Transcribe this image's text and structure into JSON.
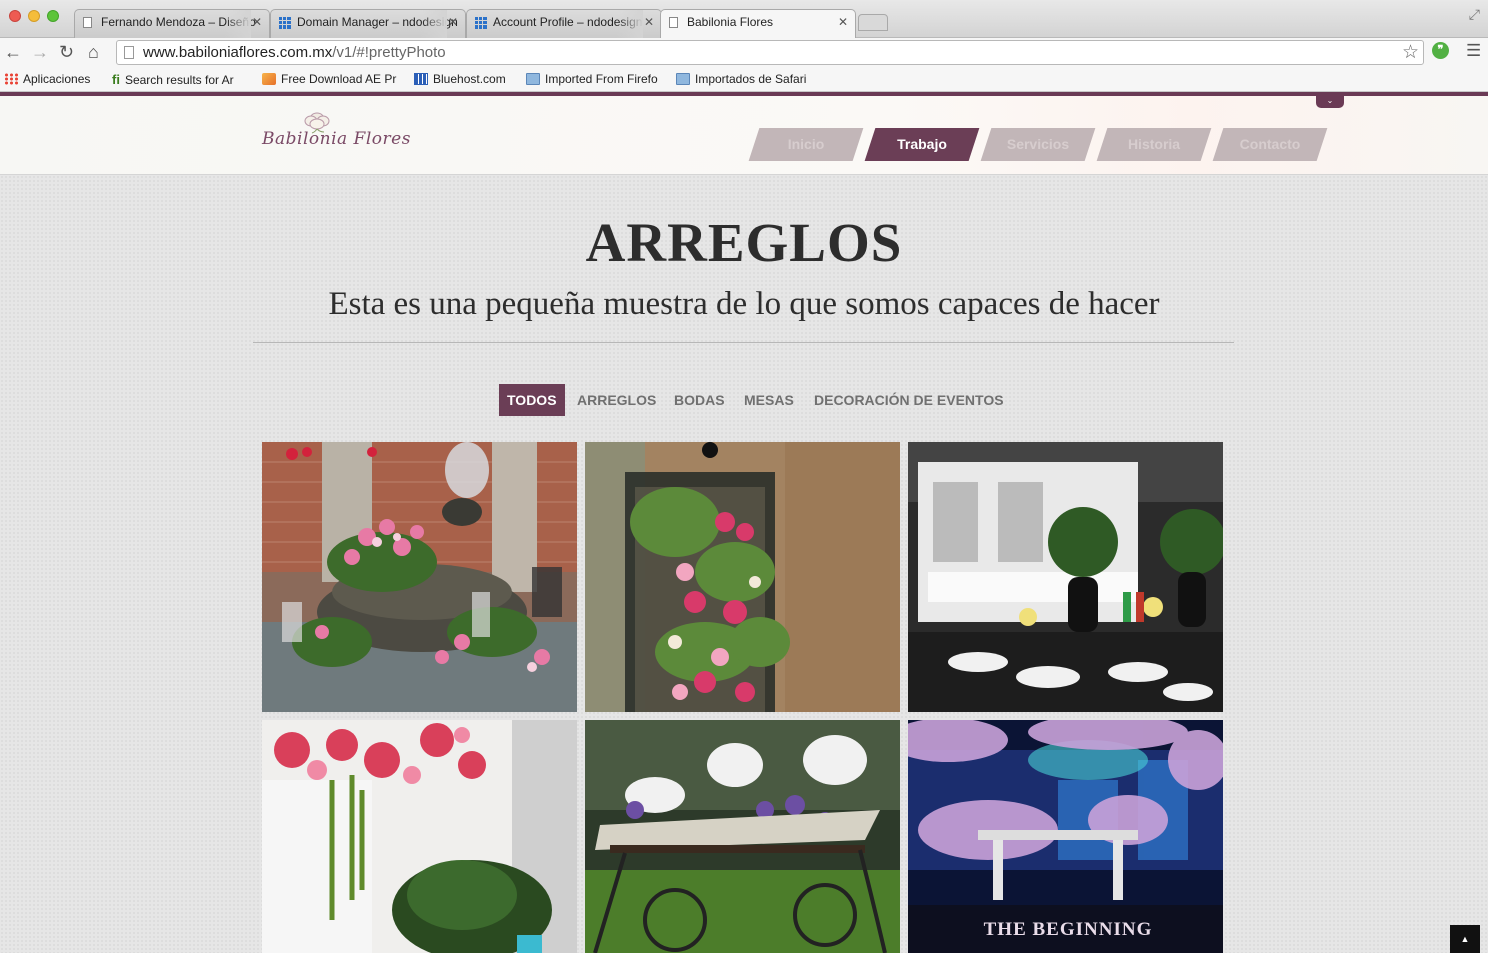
{
  "browser": {
    "tabs": [
      {
        "title": "Fernando Mendoza – Diseño",
        "icon": "page-icon"
      },
      {
        "title": "Domain Manager – ndodesign",
        "icon": "grid-icon"
      },
      {
        "title": "Account Profile – ndodesign",
        "icon": "grid-icon"
      },
      {
        "title": "Babilonia Flores",
        "icon": "page-icon"
      }
    ],
    "url_host": "www.babiloniaflores.com.mx",
    "url_path": "/v1/#!prettyPhoto",
    "bookmarks": [
      {
        "label": "Aplicaciones",
        "icon": "apps-icon"
      },
      {
        "label": "Search results for Ar",
        "icon": "fi-icon"
      },
      {
        "label": "Free Download AE Pr",
        "icon": "ae-icon"
      },
      {
        "label": "Bluehost.com",
        "icon": "grid-icon"
      },
      {
        "label": "Imported From Firefo",
        "icon": "folder-icon"
      },
      {
        "label": "Importados de Safari",
        "icon": "folder-icon"
      }
    ]
  },
  "site": {
    "logo_text": "Babilonia Flores",
    "nav": [
      "Inicio",
      "Trabajo",
      "Servicios",
      "Historia",
      "Contacto"
    ],
    "nav_active": "Trabajo",
    "title": "ARREGLOS",
    "subtitle": "Esta es una pequeña muestra de lo que somos capaces de hacer",
    "filters": [
      "TODOS",
      "ARREGLOS",
      "BODAS",
      "MESAS",
      "DECORACIÓN DE EVENTOS"
    ],
    "filter_active": "TODOS",
    "gallery_overlay_text": "THE BEGINNING",
    "colors": {
      "accent": "#6b3e56",
      "nav_inactive": "#c2b6b8",
      "title": "#2d2d2d"
    }
  }
}
